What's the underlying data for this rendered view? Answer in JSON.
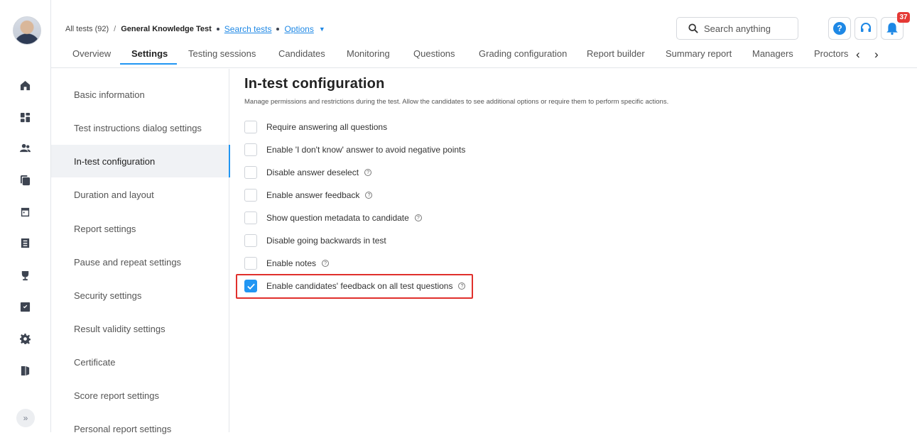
{
  "breadcrumb": {
    "all_tests": "All tests (92)",
    "separator": "/",
    "test_name": "General Knowledge Test",
    "search_tests": "Search tests",
    "options": "Options"
  },
  "tabs": [
    {
      "label": "Overview"
    },
    {
      "label": "Settings",
      "active": true
    },
    {
      "label": "Testing sessions"
    },
    {
      "label": "Candidates"
    },
    {
      "label": "Monitoring"
    },
    {
      "label": "Questions"
    },
    {
      "label": "Grading configuration"
    },
    {
      "label": "Report builder"
    },
    {
      "label": "Summary report"
    },
    {
      "label": "Managers"
    },
    {
      "label": "Proctors"
    }
  ],
  "header": {
    "search_placeholder": "Search anything",
    "help_label": "?",
    "notifications_count": "37"
  },
  "settings_menu": [
    {
      "label": "Basic information"
    },
    {
      "label": "Test instructions dialog settings"
    },
    {
      "label": "In-test configuration",
      "active": true
    },
    {
      "label": "Duration and layout"
    },
    {
      "label": "Report settings"
    },
    {
      "label": "Pause and repeat settings"
    },
    {
      "label": "Security settings"
    },
    {
      "label": "Result validity settings"
    },
    {
      "label": "Certificate"
    },
    {
      "label": "Score report settings"
    },
    {
      "label": "Personal report settings"
    }
  ],
  "section": {
    "title": "In-test configuration",
    "description": "Manage permissions and restrictions during the test. Allow the candidates to see additional options or require them to perform specific actions."
  },
  "options": [
    {
      "label": "Require answering all questions",
      "checked": false,
      "info": false
    },
    {
      "label": "Enable 'I don't know' answer to avoid negative points",
      "checked": false,
      "info": false
    },
    {
      "label": "Disable answer deselect",
      "checked": false,
      "info": true
    },
    {
      "label": "Enable answer feedback",
      "checked": false,
      "info": true
    },
    {
      "label": "Show question metadata to candidate",
      "checked": false,
      "info": true
    },
    {
      "label": "Disable going backwards in test",
      "checked": false,
      "info": false
    },
    {
      "label": "Enable notes",
      "checked": false,
      "info": true
    },
    {
      "label": "Enable candidates' feedback on all test questions",
      "checked": true,
      "info": true,
      "highlighted": true
    }
  ],
  "colors": {
    "accent": "#2196f3",
    "highlight_border": "#e0302c",
    "badge": "#e53935"
  }
}
